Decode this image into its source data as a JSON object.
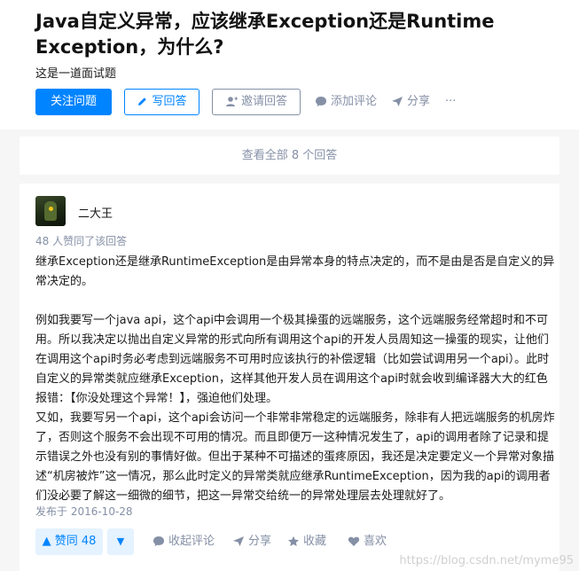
{
  "question": {
    "title": "Java自定义异常，应该继承Exception还是Runtime Exception，为什么?",
    "description": "这是一道面试题",
    "actions": {
      "follow": "关注问题",
      "write_answer": "写回答",
      "invite": "邀请回答",
      "comment": "添加评论",
      "share": "分享",
      "more": "···"
    }
  },
  "view_all": "查看全部 8 个回答",
  "answer": {
    "author": "二大王",
    "vote_summary": "48 人赞同了该回答",
    "body": "继承Exception还是继承RuntimeException是由异常本身的特点决定的，而不是由是否是自定义的异常决定的。\n\n例如我要写一个java api，这个api中会调用一个极其操蛋的远端服务，这个远端服务经常超时和不可用。所以我决定以抛出自定义异常的形式向所有调用这个api的开发人员周知这一操蛋的现实，让他们在调用这个api时务必考虑到远端服务不可用时应该执行的补偿逻辑（比如尝试调用另一个api）。此时自定义的异常类就应继承Exception，这样其他开发人员在调用这个api时就会收到编译器大大的红色报错：【你没处理这个异常！】，强迫他们处理。\n又如，我要写另一个api，这个api会访问一个非常非常稳定的远端服务，除非有人把远端服务的机房炸了，否则这个服务不会出现不可用的情况。而且即便万一这种情况发生了，api的调用者除了记录和提示错误之外也没有别的事情好做。但出于某种不可描述的蛋疼原因，我还是决定要定义一个异常对象描述“机房被炸”这一情况，那么此时定义的异常类就应继承RuntimeException，因为我的api的调用者们没必要了解这一细微的细节，把这一异常交给统一的异常处理层去处理就好了。",
    "published": "发布于 2016-10-28",
    "vote_up": "▲ 赞同 48",
    "vote_down": "▼",
    "collapse_comments": "收起评论",
    "share": "分享",
    "favorite": "收藏",
    "like": "喜欢"
  },
  "watermark": "https://blog.csdn.net/myme95",
  "colors": {
    "accent": "#0084ff",
    "muted": "#8590a6",
    "background": "#f6f6f6"
  }
}
